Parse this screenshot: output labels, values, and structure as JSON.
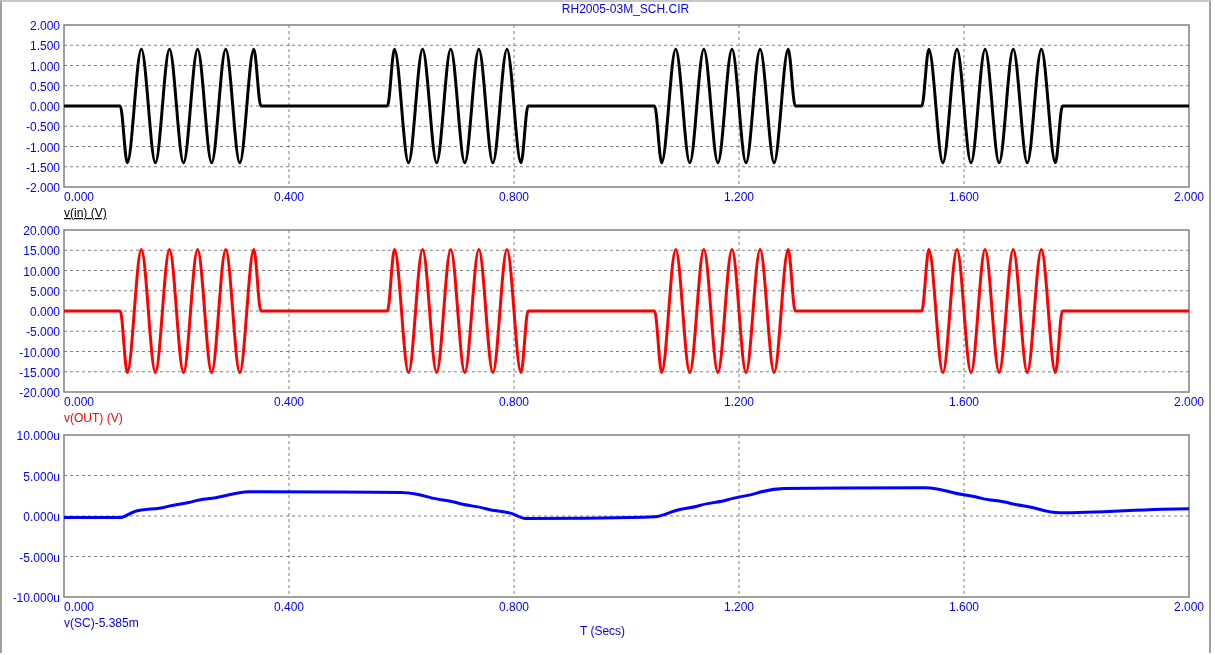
{
  "window": {
    "title": "RH2005-03M_SCH.CIR"
  },
  "charts": [
    {
      "selected": true,
      "chart_data": {
        "type": "line",
        "grid": true,
        "x": [
          0,
          0.1,
          0.1125,
          0.125,
          0.1375,
          0.15,
          0.1625,
          0.175,
          0.1875,
          0.2,
          0.2125,
          0.225,
          0.2375,
          0.25,
          0.2625,
          0.275,
          0.2875,
          0.3,
          0.3125,
          0.325,
          0.3375,
          0.35,
          0.575,
          0.5875,
          0.6,
          0.6125,
          0.625,
          0.6375,
          0.65,
          0.6625,
          0.675,
          0.6875,
          0.7,
          0.7125,
          0.725,
          0.7375,
          0.75,
          0.7625,
          0.775,
          0.7875,
          0.8,
          0.8125,
          0.825,
          1.05,
          1.0625,
          1.075,
          1.0875,
          1.1,
          1.1125,
          1.125,
          1.1375,
          1.15,
          1.1625,
          1.175,
          1.1875,
          1.2,
          1.2125,
          1.225,
          1.2375,
          1.25,
          1.2625,
          1.275,
          1.2875,
          1.3,
          1.525,
          1.5375,
          1.55,
          1.5625,
          1.575,
          1.5875,
          1.6,
          1.6125,
          1.625,
          1.6375,
          1.65,
          1.6625,
          1.675,
          1.6875,
          1.7,
          1.7125,
          1.725,
          1.7375,
          1.75,
          1.7625,
          1.775,
          2.0
        ],
        "series": [
          {
            "name": "v(in) (V)",
            "color": "#000000",
            "values": [
              0,
              0,
              -1.4,
              0,
              1.4,
              0,
              -1.4,
              0,
              1.4,
              0,
              -1.4,
              0,
              1.4,
              0,
              -1.4,
              0,
              1.4,
              0,
              -1.4,
              0,
              1.4,
              0,
              0,
              1.4,
              0,
              -1.4,
              0,
              1.4,
              0,
              -1.4,
              0,
              1.4,
              0,
              -1.4,
              0,
              1.4,
              0,
              -1.4,
              0,
              1.4,
              0,
              -1.4,
              0,
              0,
              -1.4,
              0,
              1.4,
              0,
              -1.4,
              0,
              1.4,
              0,
              -1.4,
              0,
              1.4,
              0,
              -1.4,
              0,
              1.4,
              0,
              -1.4,
              0,
              1.4,
              0,
              0,
              1.4,
              0,
              -1.4,
              0,
              1.4,
              0,
              -1.4,
              0,
              1.4,
              0,
              -1.4,
              0,
              1.4,
              0,
              -1.4,
              0,
              1.4,
              0,
              -1.4,
              0,
              0
            ]
          }
        ],
        "xlim": [
          0,
          2
        ],
        "ylim": [
          -2,
          2
        ],
        "xticks": [
          {
            "value": 0,
            "label": "0.000"
          },
          {
            "value": 0.4,
            "label": "0.400"
          },
          {
            "value": 0.8,
            "label": "0.800"
          },
          {
            "value": 1.2,
            "label": "1.200"
          },
          {
            "value": 1.6,
            "label": "1.600"
          },
          {
            "value": 2,
            "label": "2.000"
          }
        ],
        "yticks": [
          {
            "value": 2,
            "label": "2.000"
          },
          {
            "value": 1.5,
            "label": "1.500"
          },
          {
            "value": 1,
            "label": "1.000"
          },
          {
            "value": 0.5,
            "label": "0.500"
          },
          {
            "value": 0,
            "label": "0.000"
          },
          {
            "value": -0.5,
            "label": "-0.500"
          },
          {
            "value": -1,
            "label": "-1.000"
          },
          {
            "value": -1.5,
            "label": "-1.500"
          },
          {
            "value": -2,
            "label": "-2.000"
          }
        ]
      }
    },
    {
      "selected": false,
      "chart_data": {
        "type": "line",
        "grid": true,
        "x": [
          0,
          0.1,
          0.1125,
          0.125,
          0.1375,
          0.15,
          0.1625,
          0.175,
          0.1875,
          0.2,
          0.2125,
          0.225,
          0.2375,
          0.25,
          0.2625,
          0.275,
          0.2875,
          0.3,
          0.3125,
          0.325,
          0.3375,
          0.35,
          0.575,
          0.5875,
          0.6,
          0.6125,
          0.625,
          0.6375,
          0.65,
          0.6625,
          0.675,
          0.6875,
          0.7,
          0.7125,
          0.725,
          0.7375,
          0.75,
          0.7625,
          0.775,
          0.7875,
          0.8,
          0.8125,
          0.825,
          1.05,
          1.0625,
          1.075,
          1.0875,
          1.1,
          1.1125,
          1.125,
          1.1375,
          1.15,
          1.1625,
          1.175,
          1.1875,
          1.2,
          1.2125,
          1.225,
          1.2375,
          1.25,
          1.2625,
          1.275,
          1.2875,
          1.3,
          1.525,
          1.5375,
          1.55,
          1.5625,
          1.575,
          1.5875,
          1.6,
          1.6125,
          1.625,
          1.6375,
          1.65,
          1.6625,
          1.675,
          1.6875,
          1.7,
          1.7125,
          1.725,
          1.7375,
          1.75,
          1.7625,
          1.775,
          2.0
        ],
        "series": [
          {
            "name": "v(OUT) (V)",
            "color": "#ff0000",
            "values": [
              0,
              0,
              -15.2,
              0,
              15.2,
              0,
              -15.2,
              0,
              15.2,
              0,
              -15.2,
              0,
              15.2,
              0,
              -15.2,
              0,
              15.2,
              0,
              -15.2,
              0,
              15.2,
              0,
              0,
              15.2,
              0,
              -15.2,
              0,
              15.2,
              0,
              -15.2,
              0,
              15.2,
              0,
              -15.2,
              0,
              15.2,
              0,
              -15.2,
              0,
              15.2,
              0,
              -15.2,
              0,
              0,
              -15.2,
              0,
              15.2,
              0,
              -15.2,
              0,
              15.2,
              0,
              -15.2,
              0,
              15.2,
              0,
              -15.2,
              0,
              15.2,
              0,
              -15.2,
              0,
              15.2,
              0,
              0,
              15.2,
              0,
              -15.2,
              0,
              15.2,
              0,
              -15.2,
              0,
              15.2,
              0,
              -15.2,
              0,
              15.2,
              0,
              -15.2,
              0,
              15.2,
              0,
              -15.2,
              0,
              0
            ]
          }
        ],
        "xlim": [
          0,
          2
        ],
        "ylim": [
          -20,
          20
        ],
        "xticks": [
          {
            "value": 0,
            "label": "0.000"
          },
          {
            "value": 0.4,
            "label": "0.400"
          },
          {
            "value": 0.8,
            "label": "0.800"
          },
          {
            "value": 1.2,
            "label": "1.200"
          },
          {
            "value": 1.6,
            "label": "1.600"
          },
          {
            "value": 2,
            "label": "2.000"
          }
        ],
        "yticks": [
          {
            "value": 20,
            "label": "20.000"
          },
          {
            "value": 15,
            "label": "15.000"
          },
          {
            "value": 10,
            "label": "10.000"
          },
          {
            "value": 5,
            "label": "5.000"
          },
          {
            "value": 0,
            "label": "0.000"
          },
          {
            "value": -5,
            "label": "-5.000"
          },
          {
            "value": -10,
            "label": "-10.000"
          },
          {
            "value": -15,
            "label": "-15.000"
          },
          {
            "value": -20,
            "label": "-20.000"
          }
        ]
      }
    },
    {
      "selected": false,
      "chart_data": {
        "type": "line",
        "grid": true,
        "xlabel": "T (Secs)",
        "x": [
          0,
          0.1,
          0.12,
          0.18,
          0.23,
          0.28,
          0.33,
          0.6,
          0.65,
          0.7,
          0.75,
          0.8,
          0.82,
          1.05,
          1.08,
          1.13,
          1.18,
          1.23,
          1.28,
          1.53,
          1.58,
          1.63,
          1.68,
          1.73,
          1.77,
          2.0
        ],
        "series": [
          {
            "name": "v(SC)-5.385m",
            "color": "#0000ff",
            "values": [
              -0.2,
              -0.2,
              0.4,
              1.1,
              1.8,
              2.4,
              3.0,
              2.9,
              2.3,
              1.6,
              0.9,
              0.2,
              -0.3,
              -0.1,
              0.5,
              1.3,
              2.0,
              2.8,
              3.4,
              3.5,
              2.9,
              2.2,
              1.6,
              0.9,
              0.4,
              0.9
            ]
          }
        ],
        "xlim": [
          0,
          2
        ],
        "ylim": [
          -10,
          10
        ],
        "xticks": [
          {
            "value": 0,
            "label": "0.000"
          },
          {
            "value": 0.4,
            "label": "0.400"
          },
          {
            "value": 0.8,
            "label": "0.800"
          },
          {
            "value": 1.2,
            "label": "1.200"
          },
          {
            "value": 1.6,
            "label": "1.600"
          },
          {
            "value": 2,
            "label": "2.000"
          }
        ],
        "yticks": [
          {
            "value": 10,
            "label": "10.000u"
          },
          {
            "value": 5,
            "label": "5.000u"
          },
          {
            "value": 0,
            "label": "0.000u"
          },
          {
            "value": -5,
            "label": "-5.000u"
          },
          {
            "value": -10,
            "label": "-10.000u"
          }
        ]
      }
    }
  ]
}
